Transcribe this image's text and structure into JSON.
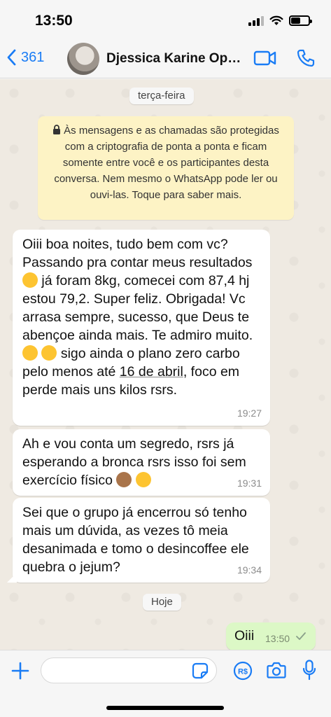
{
  "status_bar": {
    "time": "13:50"
  },
  "header": {
    "back_count": "361",
    "contact_name": "Djessica Karine Opp..."
  },
  "chat": {
    "date_separator_1": "terça-feira",
    "encryption_notice": "Às mensagens e as chamadas são protegidas com a criptografia de ponta a ponta e ficam somente entre você e os participantes desta conversa. Nem mesmo o WhatsApp pode ler ou ouvi-las. Toque para saber mais.",
    "messages": [
      {
        "part1": "Oiii boa noites, tudo bem com vc? Passando pra contar meus resultados ",
        "part2": " já foram 8kg, comecei com 87,4 hj estou 79,2. Super feliz. Obrigada! Vc arrasa sempre, sucesso, que Deus te abençoe ainda mais. Te admiro muito. ",
        "part3": " sigo ainda o plano zero carbo pelo menos até ",
        "date_link": "16 de abril",
        "part4": ", foco em perde mais uns kilos rsrs.",
        "time": "19:27"
      },
      {
        "part1": "Ah e vou conta um segredo, rsrs já esperando a bronca rsrs isso foi sem exercício físico ",
        "time": "19:31"
      },
      {
        "text": "Sei que o grupo já encerrou só tenho mais um dúvida, as vezes tô meia desanimada e tomo o desincoffee ele quebra o jejum?",
        "time": "19:34"
      }
    ],
    "date_separator_2": "Hoje",
    "outgoing": {
      "text": "Oiii",
      "time": "13:50"
    }
  },
  "colors": {
    "accent": "#1a7cf5",
    "chat_background": "#efeae2",
    "outgoing_bubble": "#dcf8c6",
    "notice_background": "#fdf3c5"
  },
  "icons": [
    "back-chevron-icon",
    "video-call-icon",
    "voice-call-icon",
    "lock-icon",
    "plus-icon",
    "sticker-icon",
    "payment-icon",
    "camera-icon",
    "microphone-icon",
    "read-check-icon"
  ]
}
